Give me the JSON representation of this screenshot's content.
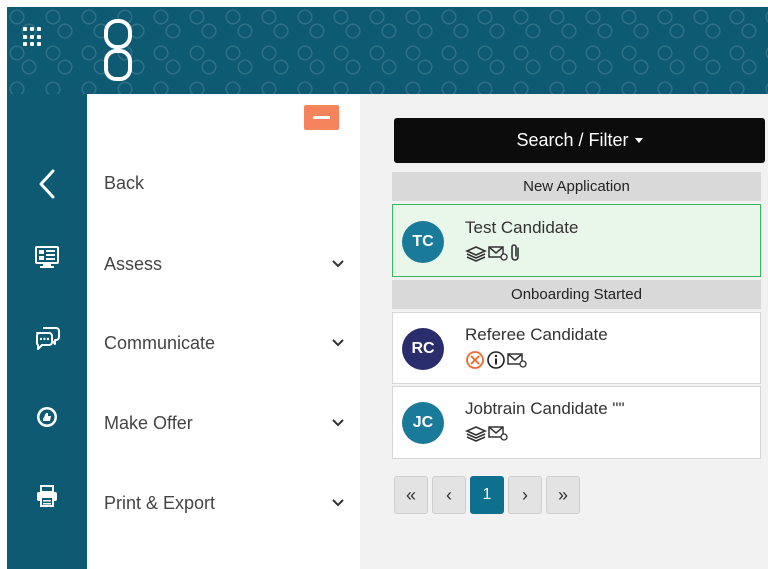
{
  "menu": {
    "items": [
      {
        "label": "Back"
      },
      {
        "label": "Assess"
      },
      {
        "label": "Communicate"
      },
      {
        "label": "Make Offer"
      },
      {
        "label": "Print & Export"
      }
    ]
  },
  "search": {
    "label": "Search / Filter"
  },
  "groups": [
    {
      "title": "New Application",
      "candidates": [
        {
          "initials": "TC",
          "name": "Test Candidate",
          "avatar_color": "#1a7a99",
          "selected": true,
          "status_icons": [
            "stack-icon",
            "mail-icon",
            "paperclip-icon"
          ]
        }
      ]
    },
    {
      "title": "Onboarding Started",
      "candidates": [
        {
          "initials": "RC",
          "name": "Referee Candidate",
          "avatar_color": "#2a2d6b",
          "selected": false,
          "status_icons": [
            "error-circle-icon",
            "info-circle-icon",
            "mail-icon"
          ]
        },
        {
          "initials": "JC",
          "name": "Jobtrain Candidate \"\"",
          "avatar_color": "#1a7a99",
          "selected": false,
          "status_icons": [
            "stack-icon",
            "mail-icon"
          ]
        }
      ]
    }
  ],
  "pagination": {
    "first": "«",
    "prev": "‹",
    "current": "1",
    "next": "›",
    "last": "»"
  },
  "colors": {
    "brand": "#0e5a73",
    "accent": "#f5845c",
    "selected_border": "#3cb35a",
    "page_active": "#0e6f8e"
  }
}
